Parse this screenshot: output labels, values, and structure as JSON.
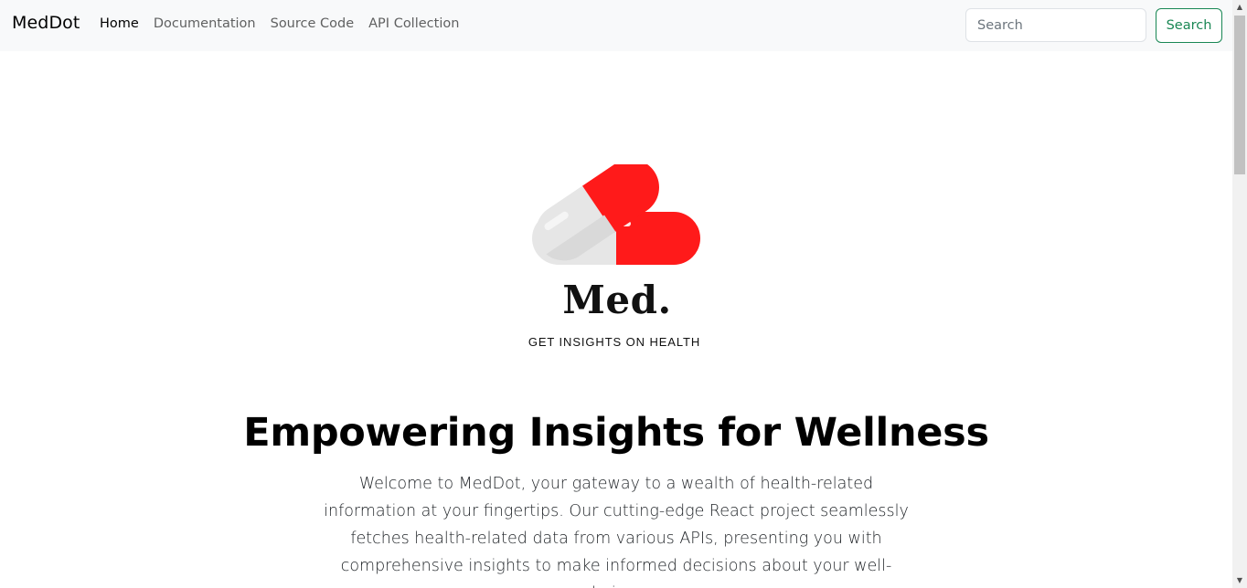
{
  "navbar": {
    "brand": "MedDot",
    "links": [
      {
        "label": "Home",
        "active": true
      },
      {
        "label": "Documentation",
        "active": false
      },
      {
        "label": "Source Code",
        "active": false
      },
      {
        "label": "API Collection",
        "active": false
      }
    ],
    "search": {
      "placeholder": "Search",
      "value": "",
      "button_label": "Search"
    }
  },
  "logo": {
    "wordmark": "Med.",
    "tagline": "GET INSIGHTS ON HEALTH",
    "icon": "pill-capsules-icon"
  },
  "hero": {
    "title": "Empowering Insights for Wellness",
    "description": "Welcome to MedDot, your gateway to a wealth of health-related information at your fingertips. Our cutting-edge React project seamlessly fetches health-related data from various APIs, presenting you with comprehensive insights to make informed decisions about your well-being."
  },
  "colors": {
    "navbar_bg": "#f8f9fa",
    "accent_green": "#198754",
    "pill_red": "#ff1a1a",
    "pill_grey": "#e6e6e6"
  }
}
